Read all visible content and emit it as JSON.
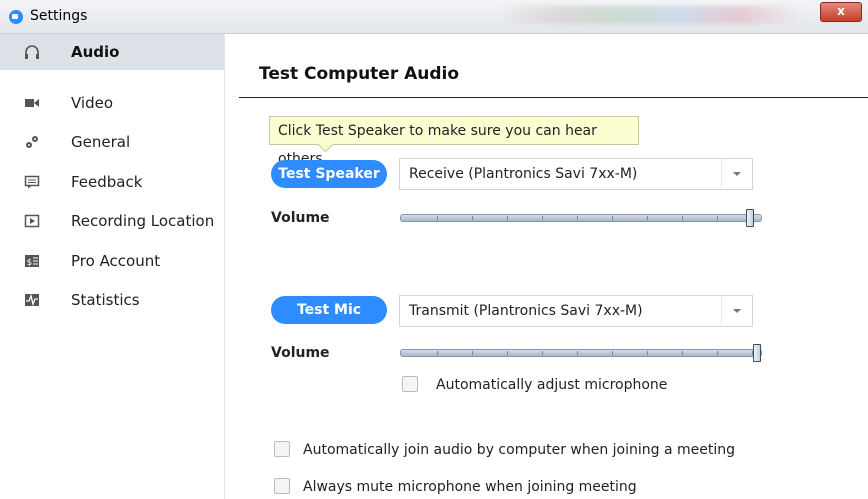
{
  "window": {
    "title": "Settings",
    "close_label": "x"
  },
  "sidebar": {
    "items": [
      {
        "label": "Audio",
        "icon": "headphones-icon",
        "active": true
      },
      {
        "label": "Video",
        "icon": "video-camera-icon",
        "active": false
      },
      {
        "label": "General",
        "icon": "gears-icon",
        "active": false
      },
      {
        "label": "Feedback",
        "icon": "feedback-icon",
        "active": false
      },
      {
        "label": "Recording Location",
        "icon": "recording-location-icon",
        "active": false
      },
      {
        "label": "Pro Account",
        "icon": "pro-account-icon",
        "active": false
      },
      {
        "label": "Statistics",
        "icon": "statistics-icon",
        "active": false
      }
    ]
  },
  "main": {
    "heading": "Test Computer Audio",
    "tooltip": "Click Test Speaker to make sure you can hear others",
    "speaker": {
      "button_label": "Test Speaker",
      "device": "Receive (Plantronics Savi 7xx-M)",
      "volume_label": "Volume",
      "volume_fraction": 0.98
    },
    "mic": {
      "button_label": "Test Mic",
      "device": "Transmit (Plantronics Savi 7xx-M)",
      "volume_label": "Volume",
      "volume_fraction": 1.0,
      "auto_adjust_label": "Automatically adjust microphone",
      "auto_adjust_checked": false
    },
    "auto_join_label": "Automatically join audio by computer when joining a meeting",
    "auto_join_checked": false,
    "always_mute_label": "Always mute microphone when joining meeting",
    "always_mute_checked": false
  },
  "colors": {
    "accent": "#2d8cff",
    "sidebar_active": "#dde2e9",
    "tooltip_bg": "#fdfdd2",
    "close_button": "#c3402c"
  }
}
